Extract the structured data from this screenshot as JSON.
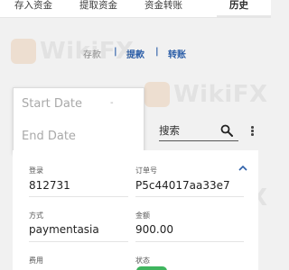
{
  "tabs": [
    {
      "label": "存入资金"
    },
    {
      "label": "提取资金"
    },
    {
      "label": "资金转账"
    },
    {
      "label": "历史"
    }
  ],
  "subnav": {
    "items": [
      "存款",
      "提款",
      "转账"
    ],
    "separator": "|"
  },
  "date_filter": {
    "start_placeholder": "Start Date",
    "end_placeholder": "End Date",
    "dash": "-"
  },
  "search": {
    "label": "搜索",
    "icon": "search-icon"
  },
  "record": {
    "login_label": "登录",
    "login_value": "812731",
    "order_label": "订单号",
    "order_value": "P5c44017aa33e7",
    "method_label": "方式",
    "method_value": "paymentasia",
    "amount_label": "金额",
    "amount_value": "900.00",
    "fee_label": "费用",
    "status_label": "状态",
    "status_color": "#3fb55e"
  },
  "watermark": {
    "text": "WikiFX",
    "brand_color": "#d9822b"
  },
  "colors": {
    "accent": "#2d5fa8"
  }
}
